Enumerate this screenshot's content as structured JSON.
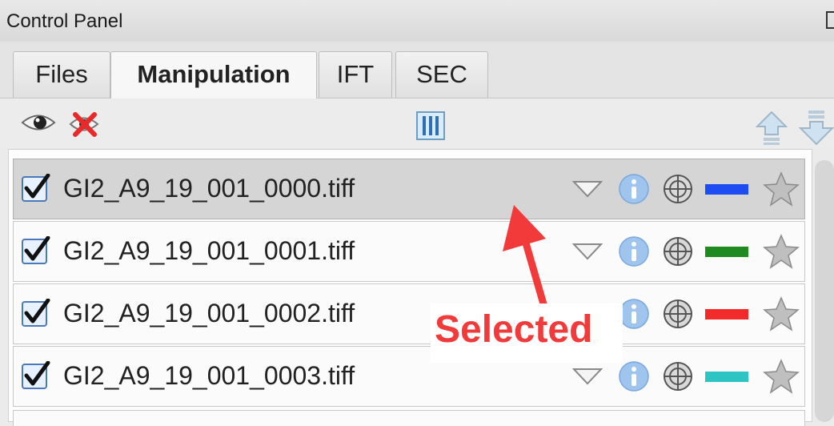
{
  "panel": {
    "title": "Control Panel"
  },
  "tabs": [
    {
      "label": "Files",
      "active": false
    },
    {
      "label": "Manipulation",
      "active": true
    },
    {
      "label": "IFT",
      "active": false
    },
    {
      "label": "SEC",
      "active": false
    }
  ],
  "toolbar": {
    "icons": [
      "eye-icon",
      "hide-all-icon",
      "columns-icon",
      "move-up-icon",
      "move-down-icon"
    ]
  },
  "files": [
    {
      "name": "GI2_A9_19_001_0000.tiff",
      "checked": true,
      "color": "#1d4cf2",
      "selected": true
    },
    {
      "name": "GI2_A9_19_001_0001.tiff",
      "checked": true,
      "color": "#1f8a1f",
      "selected": false
    },
    {
      "name": "GI2_A9_19_001_0002.tiff",
      "checked": true,
      "color": "#f22a2a",
      "selected": false
    },
    {
      "name": "GI2_A9_19_001_0003.tiff",
      "checked": true,
      "color": "#2ec4c4",
      "selected": false
    }
  ],
  "annotation": {
    "text": "Selected",
    "color": "#f23a3a"
  }
}
